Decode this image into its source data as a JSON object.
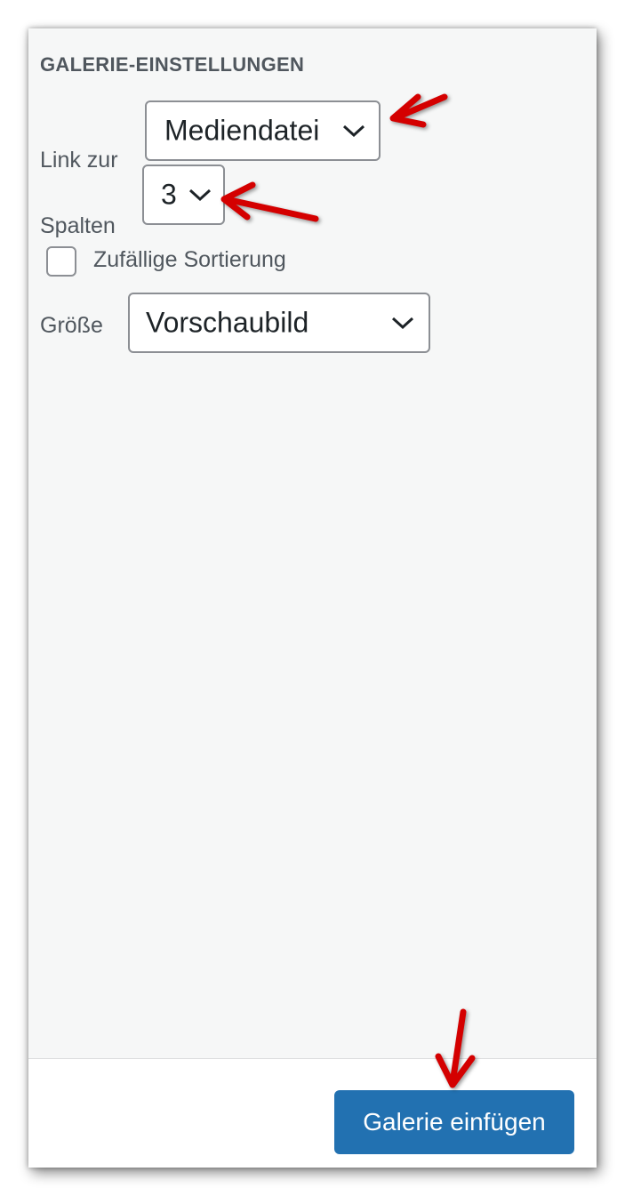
{
  "section": {
    "heading": "GALERIE-EINSTELLUNGEN"
  },
  "link_to": {
    "label": "Link zur",
    "value": "Mediendatei"
  },
  "columns": {
    "label": "Spalten",
    "value": "3"
  },
  "random_order": {
    "label": "Zufällige Sortierung",
    "checked": false
  },
  "size": {
    "label": "Größe",
    "value": "Vorschaubild"
  },
  "footer": {
    "insert_button": "Galerie einfügen"
  },
  "colors": {
    "panel_bg": "#f6f7f7",
    "primary": "#2271b1",
    "annotation_arrow": "#d40000"
  },
  "icons": [
    "chevron-down-icon",
    "annotation-arrow"
  ]
}
